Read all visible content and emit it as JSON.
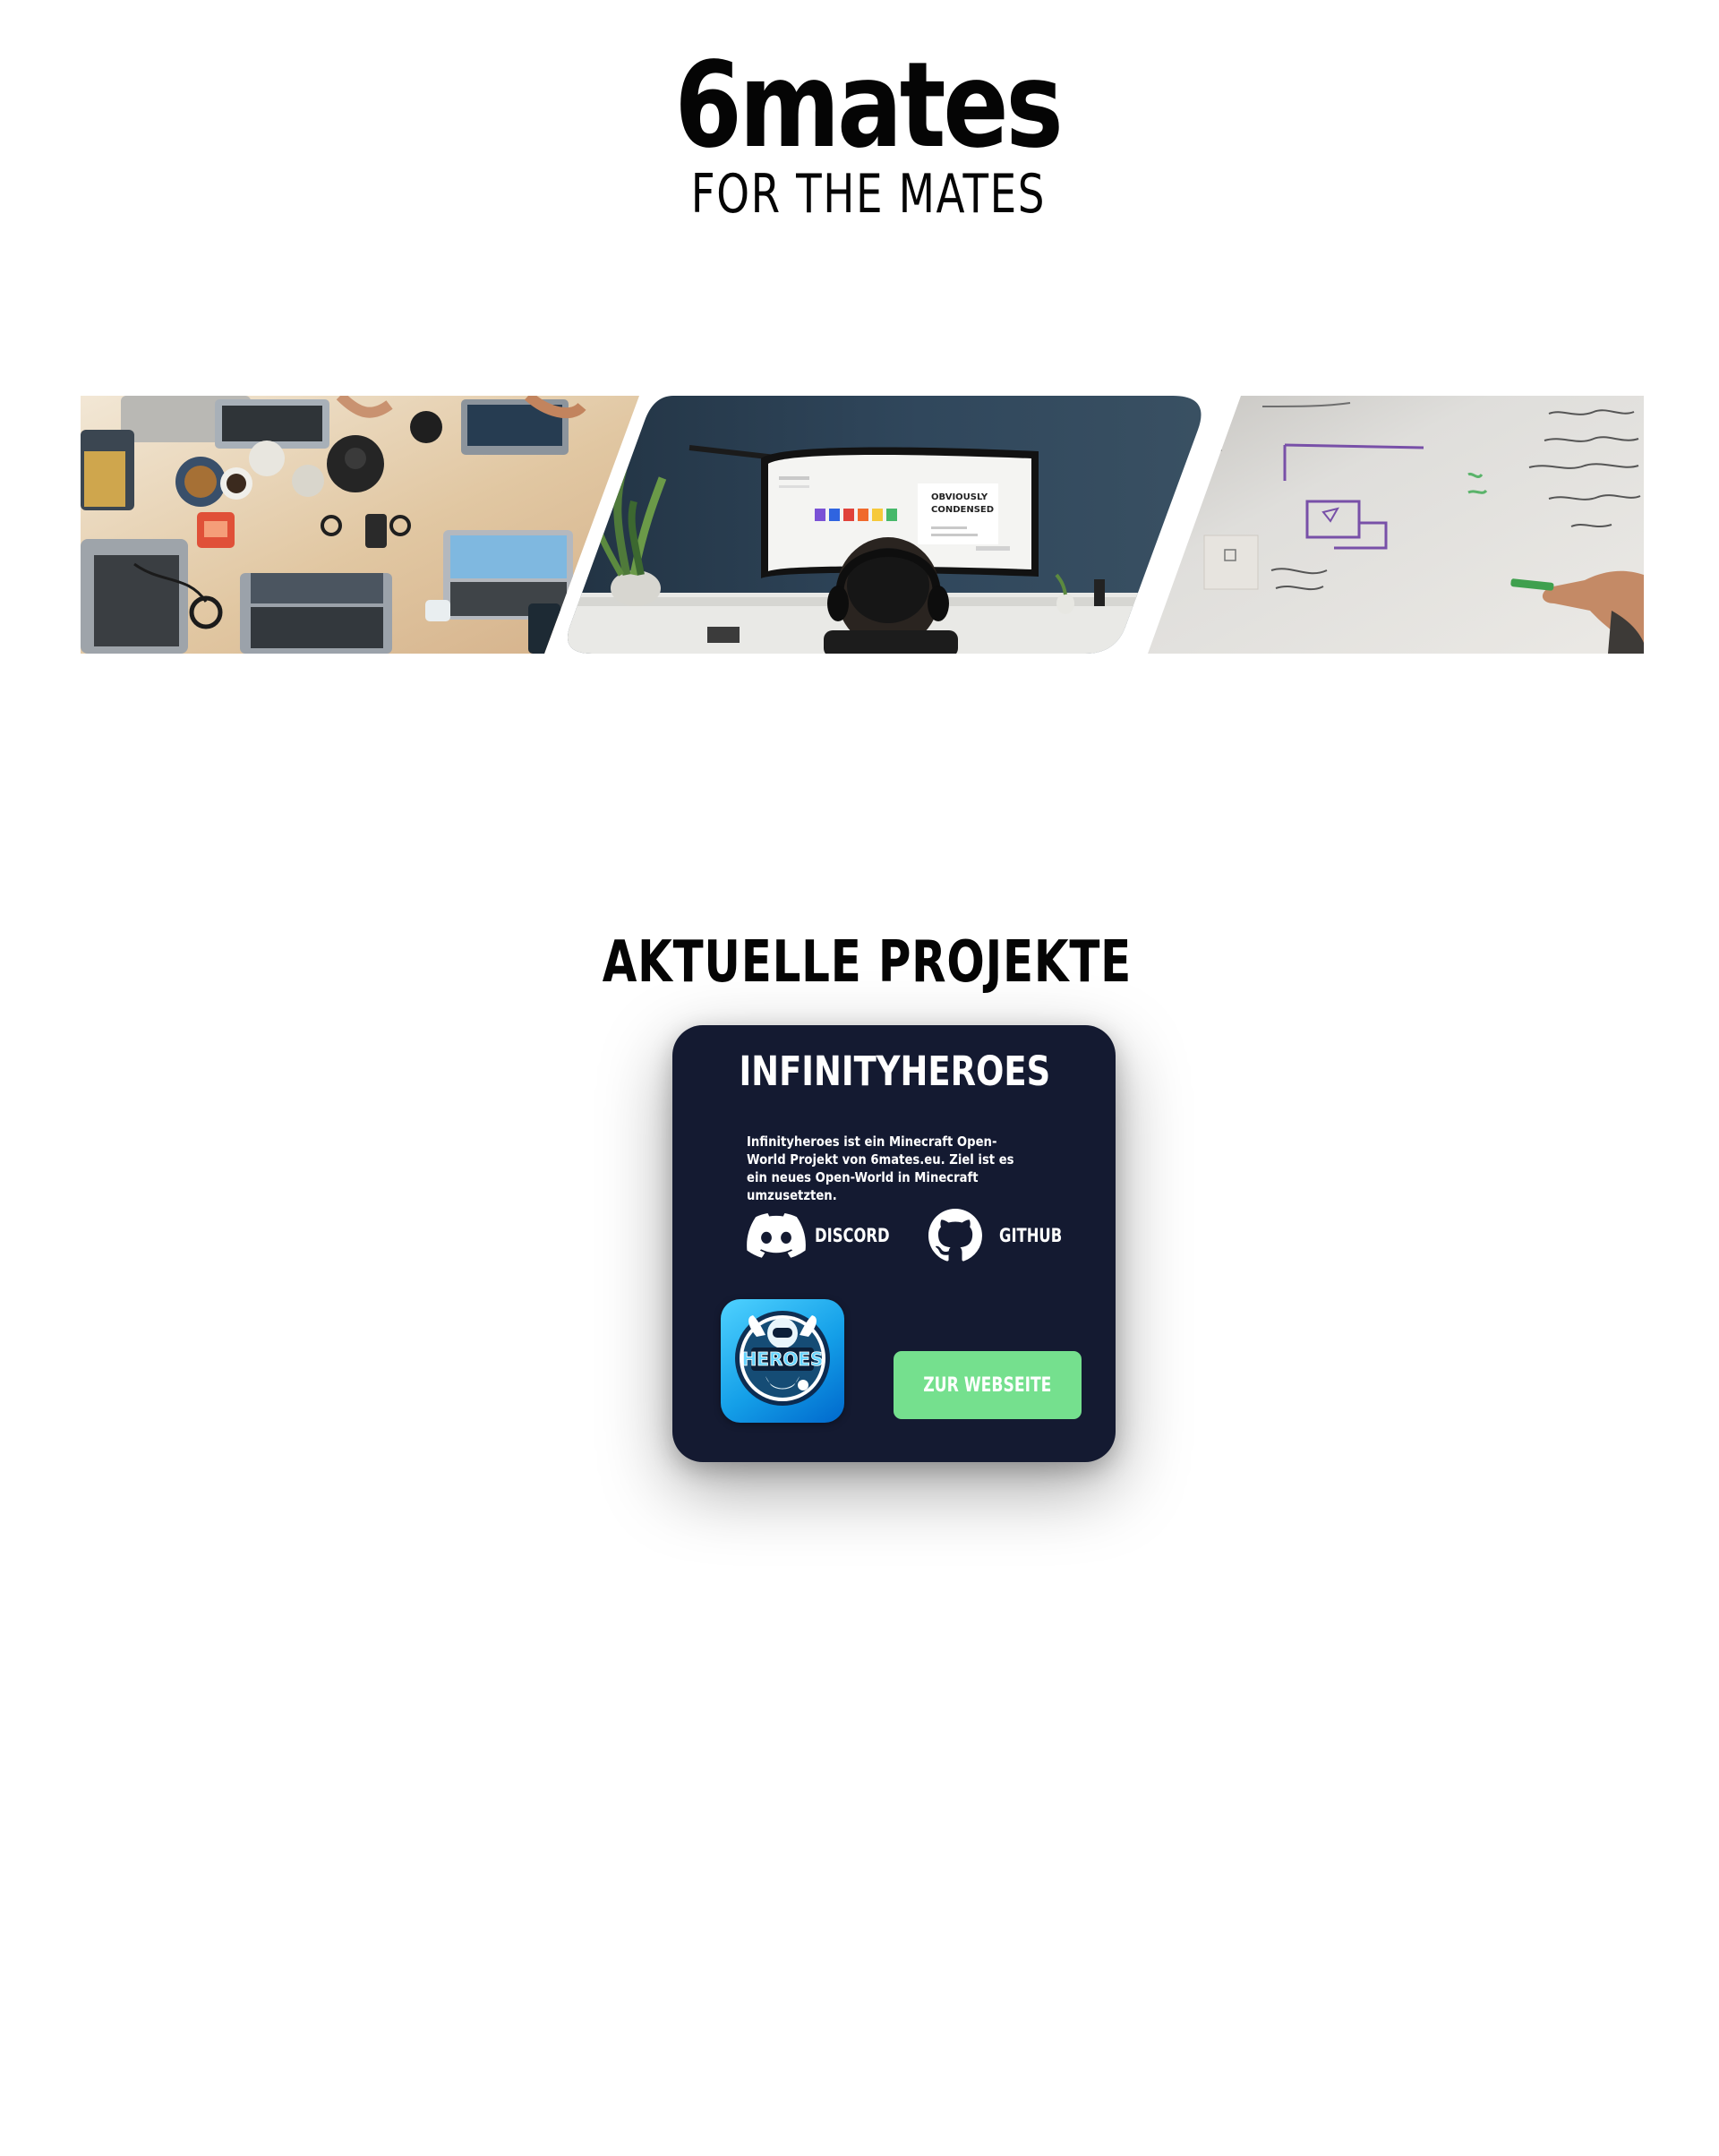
{
  "header": {
    "brand": "6mates",
    "tagline": "FOR THE MATES"
  },
  "gallery": {
    "images": [
      {
        "icon": "team-laptops-desk-photo"
      },
      {
        "icon": "developer-at-monitor-photo",
        "monitor_text": "OBVIOUSLY CONDENSED"
      },
      {
        "icon": "whiteboard-planning-photo"
      }
    ]
  },
  "projects": {
    "section_title": "AKTUELLE PROJEKTE",
    "cards": [
      {
        "title": "INFINITYHEROES",
        "description": "Infinityheroes ist ein Minecraft Open-World Projekt von 6mates.eu. Ziel ist es ein neues Open-World in Minecraft umzusetzten.",
        "links": [
          {
            "label": "DISCORD",
            "icon": "discord-icon"
          },
          {
            "label": "GITHUB",
            "icon": "github-icon"
          }
        ],
        "logo": {
          "icon": "infinityheroes-logo",
          "text": "HEROES"
        },
        "cta_label": "ZUR WEBSEITE"
      }
    ]
  },
  "colors": {
    "card_bg": "#141a31",
    "cta_bg": "#75e08e",
    "text_dark": "#050505",
    "text_light": "#ffffff"
  }
}
